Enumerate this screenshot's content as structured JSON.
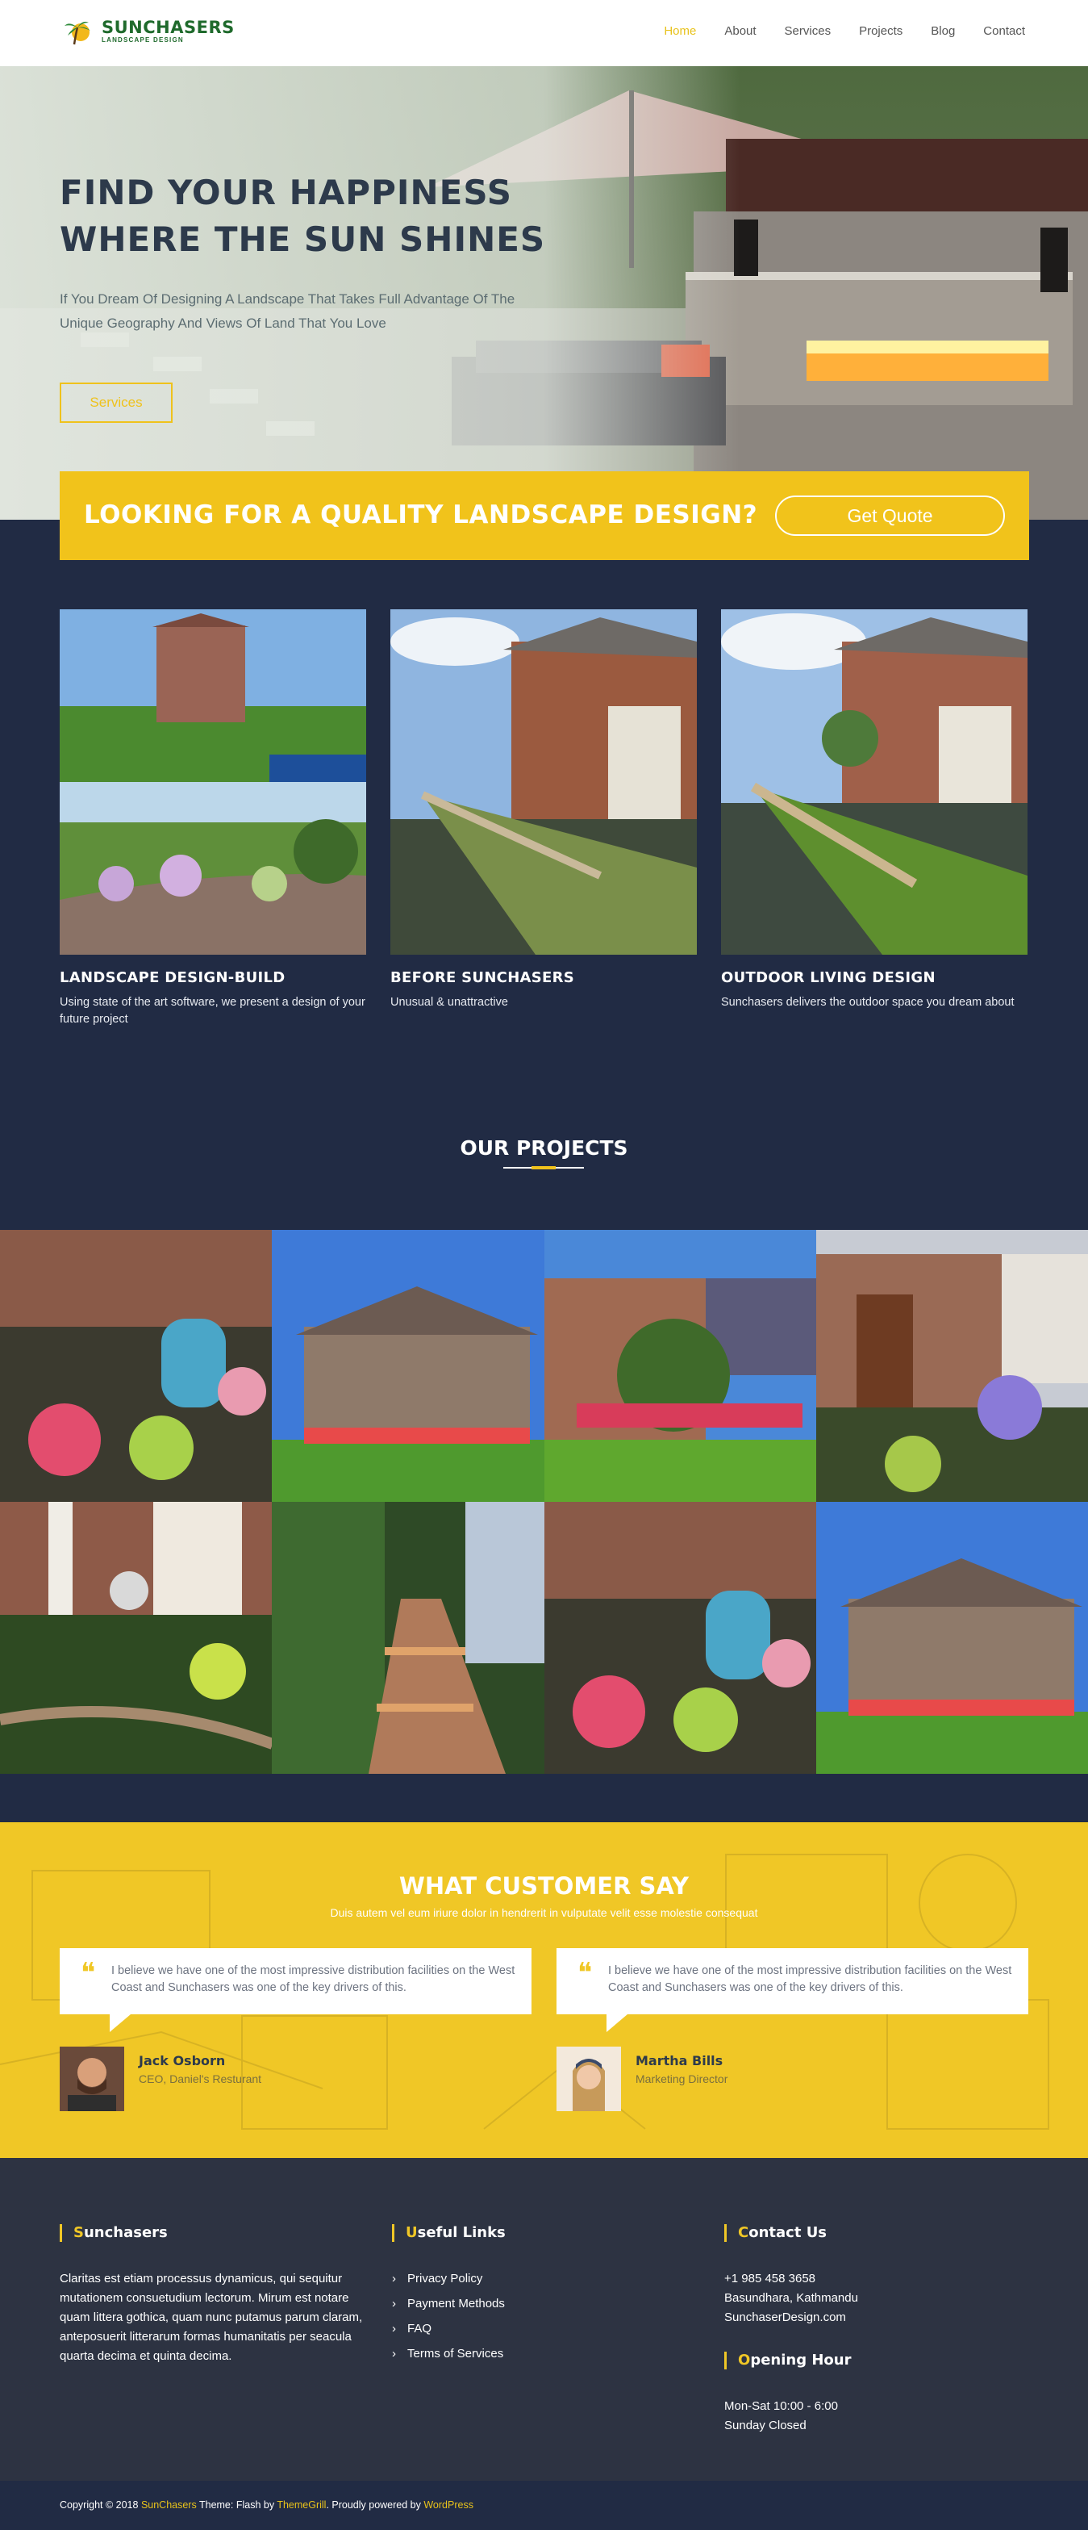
{
  "header": {
    "logo_name": "SUNCHASERS",
    "logo_tagline": "LANDSCAPE DESIGN",
    "nav": [
      "Home",
      "About",
      "Services",
      "Projects",
      "Blog",
      "Contact"
    ],
    "active_nav": "Home"
  },
  "hero": {
    "title_line1": "FIND YOUR HAPPINESS",
    "title_line2": "WHERE THE SUN SHINES",
    "text": "If You Dream Of Designing A Landscape That Takes Full Advantage Of The Unique Geography And Views Of Land That You Love",
    "button": "Services"
  },
  "quality": {
    "text": "LOOKING FOR A QUALITY LANDSCAPE DESIGN?",
    "button": "Get Quote"
  },
  "services": [
    {
      "title": "LANDSCAPE DESIGN-BUILD",
      "text": "Using state of the art software, we present a design of your future project"
    },
    {
      "title": "BEFORE SUNCHASERS",
      "text": "Unusual & unattractive"
    },
    {
      "title": "OUTDOOR LIVING DESIGN",
      "text": "Sunchasers delivers the outdoor space you dream about"
    }
  ],
  "projects": {
    "title": "OUR PROJECTS"
  },
  "testimonials": {
    "title": "WHAT CUSTOMER SAY",
    "subtitle": "Duis autem vel eum iriure dolor in hendrerit in vulputate velit esse molestie consequat",
    "items": [
      {
        "quote": "I believe we have one of the most impressive distribution facilities on the West Coast and Sunchasers was one of the key drivers of this.",
        "name": "Jack Osborn",
        "role": "CEO, Daniel's Resturant"
      },
      {
        "quote": "I believe we have one of the most impressive distribution facilities on the West Coast and Sunchasers was one of the key drivers of this.",
        "name": "Martha Bills",
        "role": "Marketing Director"
      }
    ]
  },
  "footer": {
    "about_title_first": "S",
    "about_title_rest": "unchasers",
    "about_text": "Claritas est etiam processus dynamicus, qui sequitur mutationem consuetudium lectorum. Mirum est notare quam littera gothica, quam nunc putamus parum claram, anteposuerit litterarum formas humanitatis per seacula quarta decima et quinta decima.",
    "links_title_first": "U",
    "links_title_rest": "seful Links",
    "links": [
      "Privacy Policy",
      "Payment Methods",
      "FAQ",
      "Terms of Services"
    ],
    "contact_title_first": "C",
    "contact_title_rest": "ontact Us",
    "phone": "+1 985 458 3658",
    "address": "Basundhara, Kathmandu",
    "website": "SunchaserDesign.com",
    "hours_title_first": "O",
    "hours_title_rest": "pening Hour",
    "hours1": "Mon-Sat 10:00 - 6:00",
    "hours2": "Sunday Closed"
  },
  "copyright": {
    "prefix": "Copyright © 2018 ",
    "site": "SunChasers",
    "mid": " Theme: Flash by ",
    "themegrill": "ThemeGrill",
    "mid2": ". Proudly powered by ",
    "wordpress": "WordPress"
  },
  "colors": {
    "accent": "#f0c726",
    "navy": "#212b44",
    "footer": "#2d3342"
  }
}
